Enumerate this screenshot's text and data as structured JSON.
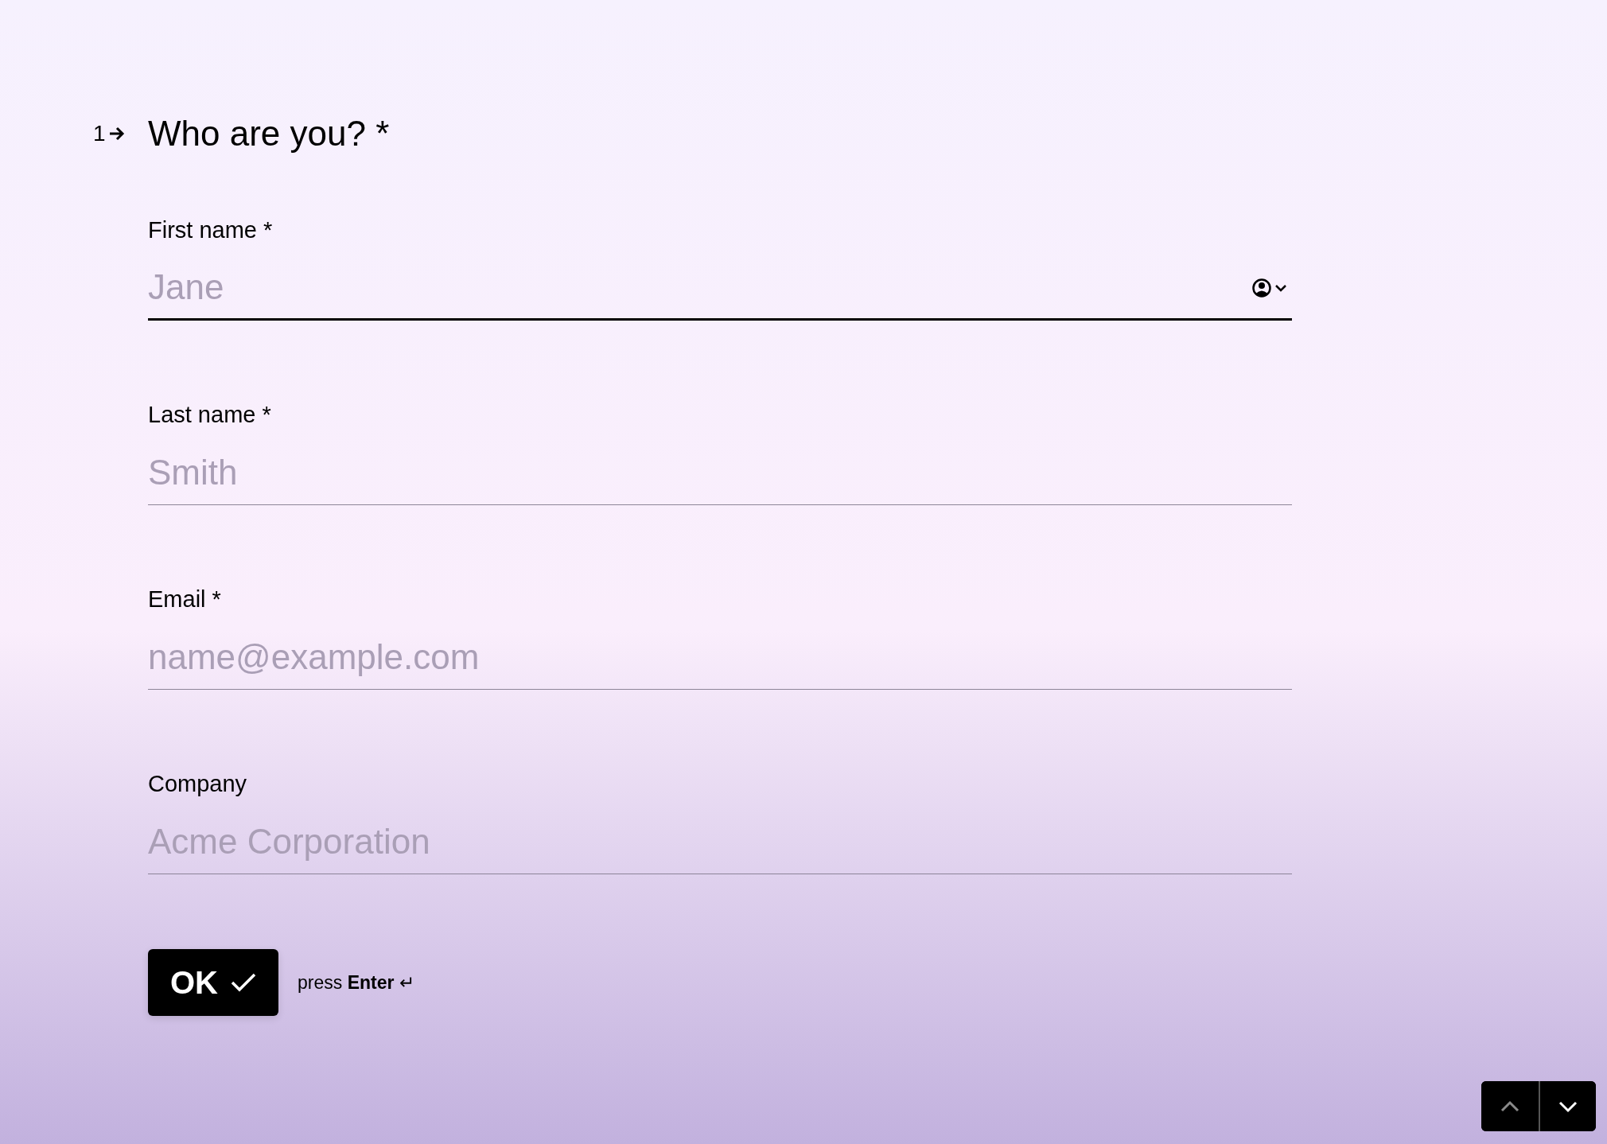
{
  "question": {
    "number": "1",
    "title": "Who are you? *"
  },
  "fields": [
    {
      "label": "First name *",
      "placeholder": "Jane",
      "focused": true,
      "autofill_icon": true
    },
    {
      "label": "Last name *",
      "placeholder": "Smith",
      "focused": false,
      "autofill_icon": false
    },
    {
      "label": "Email *",
      "placeholder": "name@example.com",
      "focused": false,
      "autofill_icon": false
    },
    {
      "label": "Company",
      "placeholder": "Acme Corporation",
      "focused": false,
      "autofill_icon": false
    }
  ],
  "submit": {
    "label": "OK",
    "hint": "press **Enter** ↵"
  },
  "navigation": [
    {
      "kind": "up",
      "disabled": true
    },
    {
      "kind": "down",
      "disabled": false
    }
  ]
}
